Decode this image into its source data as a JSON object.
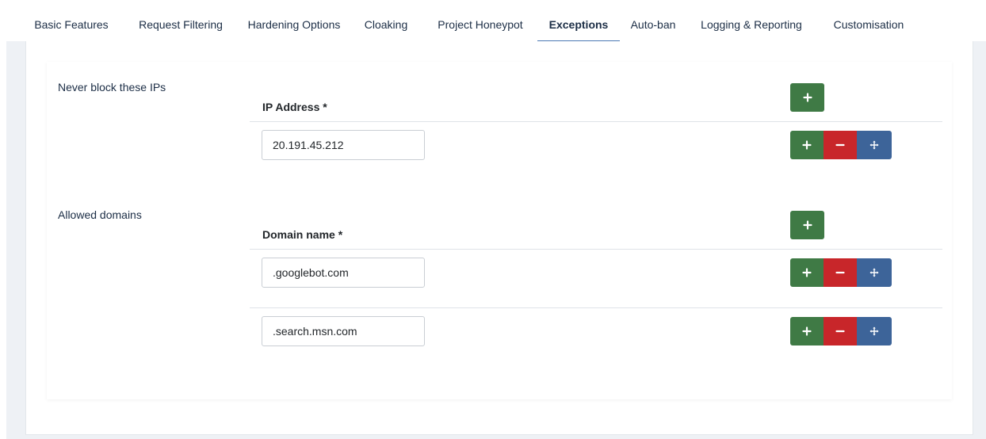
{
  "tabs": [
    {
      "label": "Basic Features",
      "active": false
    },
    {
      "label": "Request Filtering",
      "active": false
    },
    {
      "label": "Hardening Options",
      "active": false
    },
    {
      "label": "Cloaking",
      "active": false
    },
    {
      "label": "Project Honeypot",
      "active": false
    },
    {
      "label": "Exceptions",
      "active": true
    },
    {
      "label": "Auto-ban",
      "active": false
    },
    {
      "label": "Logging & Reporting",
      "active": false
    },
    {
      "label": "Customisation",
      "active": false
    }
  ],
  "ip_section": {
    "label": "Never block these IPs",
    "column_header": "IP Address *",
    "rows": [
      {
        "value": "20.191.45.212"
      }
    ]
  },
  "domain_section": {
    "label": "Allowed domains",
    "column_header": "Domain name *",
    "rows": [
      {
        "value": ".googlebot.com"
      },
      {
        "value": ".search.msn.com"
      }
    ]
  },
  "icons": {
    "add": "plus-icon",
    "remove": "minus-icon",
    "move": "move-arrows-icon"
  },
  "colors": {
    "add": "#3f7a45",
    "remove": "#c8262a",
    "move": "#3d6499",
    "active_tab_underline": "#4a78b4",
    "text": "#1b2d45"
  }
}
